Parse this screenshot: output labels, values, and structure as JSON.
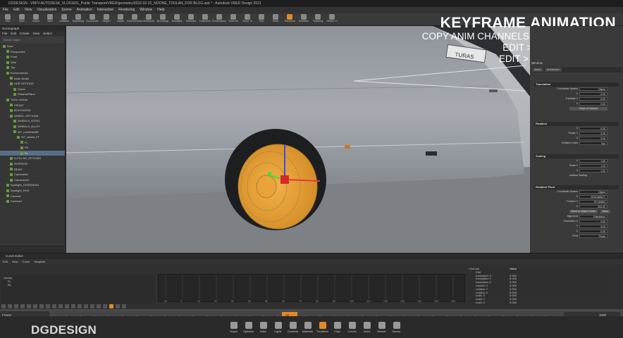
{
  "window": {
    "title": "DGDESIGN - VRFV:AUTODESK_VLOGS/01_Public Transport/VRED/geometry/2022-02-22_NOONE_TDOLAN_FOR BLOG.vpb * - Autodesk VRED Design 2021"
  },
  "menu": [
    "File",
    "Edit",
    "View",
    "Visualization",
    "Scene",
    "Animation",
    "Interaction",
    "Rendering",
    "Window",
    "Help"
  ],
  "toolbar": [
    {
      "label": "New",
      "icon": "new-file-icon"
    },
    {
      "label": "Open",
      "icon": "open-folder-icon"
    },
    {
      "label": "Import",
      "icon": "import-icon"
    },
    {
      "label": "Save",
      "icon": "save-icon"
    },
    {
      "label": "Antialias",
      "icon": "antialias-icon"
    },
    {
      "label": "Raytracing",
      "icon": "raytracing-icon"
    },
    {
      "label": "Downscale",
      "icon": "downscale-icon"
    },
    {
      "label": "Region",
      "icon": "region-icon"
    },
    {
      "label": "Isolate",
      "icon": "isolate-icon"
    },
    {
      "label": "Environments",
      "icon": "environment-icon"
    },
    {
      "label": "Wireframe",
      "icon": "wireframe-icon"
    },
    {
      "label": "Boundings",
      "icon": "bounding-icon"
    },
    {
      "label": "Headlight",
      "icon": "headlight-icon"
    },
    {
      "label": "Statistics",
      "icon": "statistics-icon"
    },
    {
      "label": "Fullscreen",
      "icon": "fullscreen-icon"
    },
    {
      "label": "Presentation",
      "icon": "presentation-icon"
    },
    {
      "label": "Show All",
      "icon": "show-all-icon"
    },
    {
      "label": "Zoom To",
      "icon": "zoom-icon"
    },
    {
      "label": "Grid",
      "icon": "grid-icon"
    },
    {
      "label": "Ruler",
      "icon": "ruler-icon"
    },
    {
      "label": "Transform",
      "icon": "transform-icon",
      "active": true
    },
    {
      "label": "Selection",
      "icon": "selection-icon"
    },
    {
      "label": "Texturing",
      "icon": "texturing-icon"
    },
    {
      "label": "Simple UI",
      "icon": "simple-ui-icon"
    }
  ],
  "scenegraph": {
    "title": "Scenegraph",
    "menu": [
      "File",
      "Edit",
      "Create",
      "View",
      "Select"
    ],
    "search_placeholder": "Scene Graph",
    "rows": [
      {
        "label": "Root",
        "indent": 0,
        "selected": false
      },
      {
        "label": "Perspective",
        "indent": 1,
        "selected": false
      },
      {
        "label": "Front",
        "indent": 1,
        "selected": false
      },
      {
        "label": "Side",
        "indent": 1,
        "selected": false
      },
      {
        "label": "Top",
        "indent": 1,
        "selected": false
      },
      {
        "label": "Environments",
        "indent": 1,
        "selected": false
      },
      {
        "label": "basic studio",
        "indent": 2,
        "selected": false
      },
      {
        "label": "HDR OPTIONS",
        "indent": 2,
        "selected": false
      },
      {
        "label": "Dome",
        "indent": 3,
        "selected": false
      },
      {
        "label": "ShadowPlane",
        "indent": 3,
        "selected": false
      },
      {
        "label": "TDOL vehicle",
        "indent": 1,
        "selected": false
      },
      {
        "label": "FRONT",
        "indent": 2,
        "selected": false
      },
      {
        "label": "BODYWORK",
        "indent": 2,
        "selected": false
      },
      {
        "label": "WHEEL_OPTIONS",
        "indent": 2,
        "selected": false
      },
      {
        "label": "WHEELS_STEEL",
        "indent": 3,
        "selected": false
      },
      {
        "label": "WHEELS_ALLOY",
        "indent": 3,
        "selected": false
      },
      {
        "label": "WT_LUMINAIRE",
        "indent": 3,
        "selected": false
      },
      {
        "label": "WT_wheel_FT",
        "indent": 4,
        "selected": false
      },
      {
        "label": "FL",
        "indent": 5,
        "selected": false
      },
      {
        "label": "FR",
        "indent": 5,
        "selected": false
      },
      {
        "label": "RL",
        "indent": 5,
        "selected": true
      },
      {
        "label": "A-PILLAR_OPTIONS",
        "indent": 2,
        "selected": false
      },
      {
        "label": "INTERIOR",
        "indent": 2,
        "selected": false
      },
      {
        "label": "REAR",
        "indent": 2,
        "selected": false
      },
      {
        "label": "Camerafan",
        "indent": 2,
        "selected": false
      },
      {
        "label": "CameraVert",
        "indent": 2,
        "selected": false
      },
      {
        "label": "Spotlight_OVERHEAD",
        "indent": 1,
        "selected": false
      },
      {
        "label": "Spotlight_RHS",
        "indent": 1,
        "selected": false
      },
      {
        "label": "Camera",
        "indent": 1,
        "selected": false
      },
      {
        "label": "Camera1",
        "indent": 1,
        "selected": false
      }
    ]
  },
  "overlay": {
    "heading": "KEYFRAME ANIMATION",
    "lines": [
      "COPY ANIM CHANNELS  TO NEW OBJECTS",
      "EDIT > COPY ANIMATION",
      "EDIT > PASTE ANIMATION"
    ]
  },
  "viewport": {
    "sign_text": "TURAS"
  },
  "transform_panel": {
    "title": "Window",
    "tabs": [
      "Basic",
      "Advanced"
    ],
    "translation": {
      "header": "Translation",
      "coordinate_system": "Object",
      "fields": [
        {
          "label": "Coordinate System",
          "value": "Object"
        },
        {
          "label": "X",
          "value": "0.00"
        },
        {
          "label": "Translate Y",
          "value": "0.00"
        },
        {
          "label": "Z",
          "value": "0.00"
        }
      ],
      "button": "Move to Camera"
    },
    "rotation": {
      "header": "Rotation",
      "fields": [
        {
          "label": "X",
          "value": "0.00"
        },
        {
          "label": "Rotate Y",
          "value": "0.00"
        },
        {
          "label": "Z",
          "value": "0.00"
        },
        {
          "label": "Rotation Order",
          "value": "Xyz"
        }
      ]
    },
    "scaling": {
      "header": "Scaling",
      "fields": [
        {
          "label": "X",
          "value": "1.00"
        },
        {
          "label": "Scale Y",
          "value": "1.00"
        },
        {
          "label": "Z",
          "value": "1.00"
        }
      ],
      "checkbox": "Uniform Scaling"
    },
    "pivot": {
      "header": "Rotation Pivot",
      "fields": [
        {
          "label": "Coordinate System",
          "value": "Object"
        },
        {
          "label": "X",
          "value": "-9218.668677"
        },
        {
          "label": "Position Y",
          "value": "797.60893"
        },
        {
          "label": "Z",
          "value": "903.90"
        }
      ],
      "buttons": [
        "Move to Object Center",
        "Move"
      ],
      "alignment": "Orientation",
      "fields2": [
        {
          "label": "Orientation X",
          "value": "0.00"
        },
        {
          "label": "Y",
          "value": "0.00"
        },
        {
          "label": "Z",
          "value": "0.00"
        }
      ],
      "pivot_label": "Pivot",
      "pivot_value": "Pivots"
    }
  },
  "curve_editor": {
    "title": "Curve Editor",
    "menu": [
      "Edit",
      "View",
      "Curve",
      "Tangents"
    ],
    "library_label": "Library",
    "library_items": [
      "FL",
      "RL"
    ],
    "channel_header": "Channel",
    "value_header": "Value",
    "channels": [
      {
        "name": "RIM",
        "value": ""
      },
      {
        "name": "translation.X",
        "value": "0.000"
      },
      {
        "name": "translation.Y",
        "value": "0.000"
      },
      {
        "name": "translation.Z",
        "value": "0.000"
      },
      {
        "name": "rotation.X",
        "value": "0.000"
      },
      {
        "name": "rotation.Y",
        "value": "0.000"
      },
      {
        "name": "rotation.Z",
        "value": "0.000"
      },
      {
        "name": "scale.X",
        "value": "0.000"
      },
      {
        "name": "scale.Y",
        "value": "0.000"
      },
      {
        "name": "scale.Z",
        "value": "0.000"
      }
    ],
    "ticks": [
      "-10",
      "0",
      "10",
      "20",
      "30",
      "40",
      "50",
      "60",
      "70",
      "80",
      "90",
      "100",
      "110",
      "120",
      "130",
      "140",
      "150",
      "160"
    ]
  },
  "timeline": {
    "start": "0",
    "current": "15",
    "end": "1000",
    "frame_label": "Frame"
  },
  "branding": {
    "logo_text": "DGDESIGN"
  },
  "dock": [
    {
      "label": "Graph",
      "icon": "graph-icon"
    },
    {
      "label": "Optimize",
      "icon": "optimize-icon"
    },
    {
      "label": "Bake",
      "icon": "bake-icon"
    },
    {
      "label": "Lights",
      "icon": "lights-icon"
    },
    {
      "label": "Cameras",
      "icon": "cameras-icon"
    },
    {
      "label": "Materials",
      "icon": "materials-icon"
    },
    {
      "label": "Transform",
      "icon": "transform-icon",
      "active": true
    },
    {
      "label": "Clips",
      "icon": "clips-icon"
    },
    {
      "label": "Curves",
      "icon": "curves-icon"
    },
    {
      "label": "Vsets",
      "icon": "vsets-icon"
    },
    {
      "label": "Render",
      "icon": "render-icon"
    },
    {
      "label": "Sensor",
      "icon": "sensor-icon"
    }
  ],
  "colors": {
    "accent": "#e08a2a",
    "selection": "#5a6d86",
    "panel": "#363636",
    "wheel": "#e8a33a"
  }
}
